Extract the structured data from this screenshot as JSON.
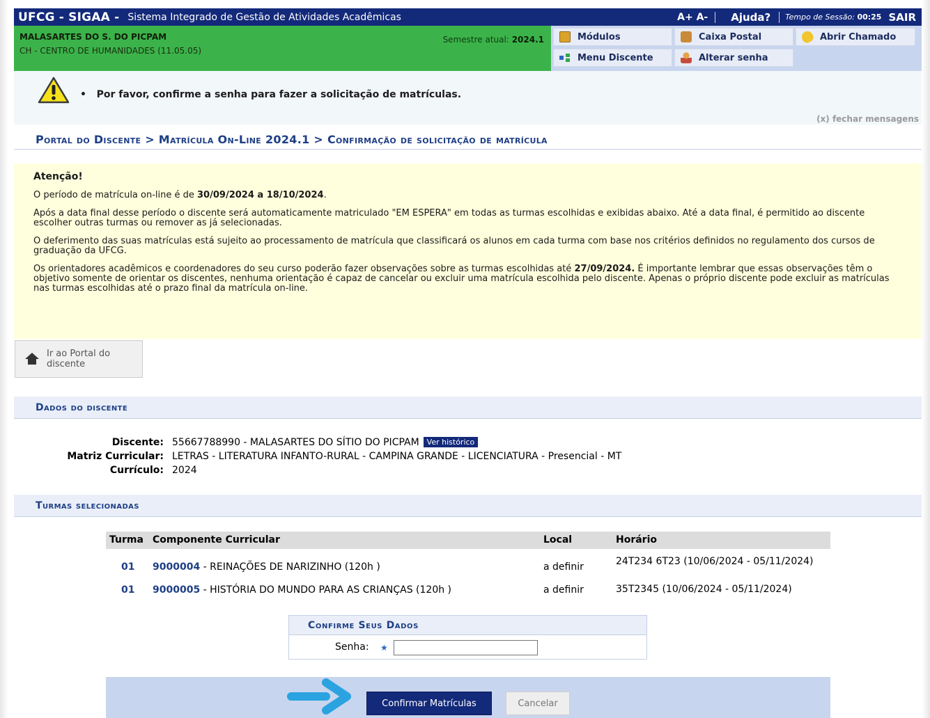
{
  "topbar": {
    "brand": "UFCG - SIGAA -",
    "description": "Sistema Integrado de Gestão de Atividades Acadêmicas",
    "font_controls": "A+ A-",
    "help": "Ajuda?",
    "session_label": "Tempo de Sessão:",
    "session_time": "00:25",
    "logout": "SAIR"
  },
  "user": {
    "name": "MALASARTES DO S. DO PICPAM",
    "unit": "CH - CENTRO DE HUMANIDADES (11.05.05)",
    "semester_label": "Semestre atual:",
    "semester": "2024.1"
  },
  "menu": {
    "modulos": "Módulos",
    "caixa_postal": "Caixa Postal",
    "abrir_chamado": "Abrir Chamado",
    "menu_discente": "Menu Discente",
    "alterar_senha": "Alterar senha"
  },
  "message": {
    "text": "Por favor, confirme a senha para fazer a solicitação de matrículas.",
    "close": "(x) fechar mensagens"
  },
  "breadcrumb": "Portal do Discente > Matrícula On-Line 2024.1 > Confirmação de solicitação de matrícula",
  "attention": {
    "title": "Atenção!",
    "p1_a": "O período de matrícula on-line é de ",
    "p1_b": "30/09/2024 a 18/10/2024",
    "p1_c": ".",
    "p2": "Após a data final desse período o discente será automaticamente matriculado \"EM ESPERA\" em todas as turmas escolhidas e exibidas abaixo. Até a data final, é permitido ao discente escolher outras turmas ou remover as já selecionadas.",
    "p3": "O deferimento das suas matrículas está sujeito ao processamento de matrícula que classificará os alunos em cada turma com base nos critérios definidos no regulamento dos cursos de graduação da UFCG.",
    "p4_a": "Os orientadores acadêmicos e coordenadores do seu curso poderão fazer observações sobre as turmas escolhidas até ",
    "p4_b": "27/09/2024.",
    "p4_c": " É importante lembrar que essas observações têm o objetivo somente de orientar os discentes, nenhuma orientação é capaz de cancelar ou excluir uma matrícula escolhida pelo discente. Apenas o próprio discente pode excluir as matrículas nas turmas escolhidas até o prazo final da matrícula on-line."
  },
  "portal_button": "Ir ao Portal do discente",
  "dados": {
    "section_title": "Dados do discente",
    "discente_label": "Discente:",
    "discente_value": "55667788990 - MALASARTES DO SÍTIO DO PICPAM",
    "historico_button": "Ver histórico",
    "matriz_label": "Matriz Curricular:",
    "matriz_value": "LETRAS - LITERATURA INFANTO-RURAL - CAMPINA GRANDE - LICENCIATURA - Presencial - MT",
    "curriculo_label": "Currículo:",
    "curriculo_value": "2024"
  },
  "turmas": {
    "section_title": "Turmas selecionadas",
    "columns": [
      "Turma",
      "Componente Curricular",
      "Local",
      "Horário"
    ],
    "rows": [
      {
        "turma": "01",
        "codigo": "9000004",
        "nome": " - REINAÇÕES DE NARIZINHO (120h )",
        "local": "a definir",
        "horario": "24T234 6T23 (10/06/2024 - 05/11/2024)"
      },
      {
        "turma": "01",
        "codigo": "9000005",
        "nome": " - HISTÓRIA DO MUNDO PARA AS CRIANÇAS (120h )",
        "local": "a definir",
        "horario": "35T2345 (10/06/2024 - 05/11/2024)"
      }
    ]
  },
  "confirm": {
    "title": "Confirme Seus Dados",
    "password_label": "Senha:",
    "required_marker": "★",
    "password_value": "",
    "confirm_button": "Confirmar Matrículas",
    "cancel_button": "Cancelar"
  },
  "colors": {
    "navy": "#13297a",
    "green": "#3bb34a",
    "link_blue": "#1e3f86",
    "attention_bg": "#ffffdd",
    "arrow_blue": "#2aa3e0"
  },
  "icons": [
    "box-icon",
    "mailbox-icon",
    "bulb-icon",
    "tree-menu-icon",
    "user-key-icon",
    "warning-icon",
    "home-icon",
    "arrow-right-icon"
  ]
}
